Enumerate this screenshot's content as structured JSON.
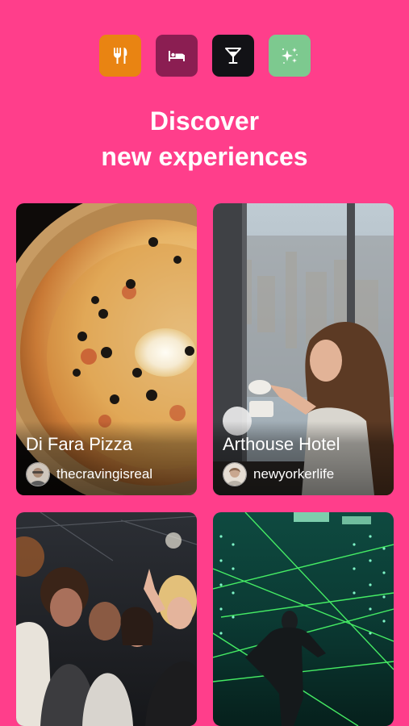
{
  "categories": [
    {
      "name": "restaurants",
      "icon": "fork-knife-icon",
      "color": "#E98412"
    },
    {
      "name": "hotels",
      "icon": "bed-icon",
      "color": "#8B1E52"
    },
    {
      "name": "nightlife",
      "icon": "cocktail-icon",
      "color": "#121216"
    },
    {
      "name": "experiences",
      "icon": "sparkles-icon",
      "color": "#7DC98F"
    }
  ],
  "headline": {
    "line1": "Discover",
    "line2": "new experiences"
  },
  "cards": [
    {
      "title": "Di Fara Pizza",
      "user": "thecravingisreal",
      "image": "pizza-photo"
    },
    {
      "title": "Arthouse Hotel",
      "user": "newyorkerlife",
      "image": "hotel-window-photo"
    },
    {
      "title": "",
      "user": "",
      "image": "party-crowd-photo"
    },
    {
      "title": "",
      "user": "",
      "image": "laser-maze-photo"
    }
  ],
  "colors": {
    "background": "#FF3E8B"
  }
}
